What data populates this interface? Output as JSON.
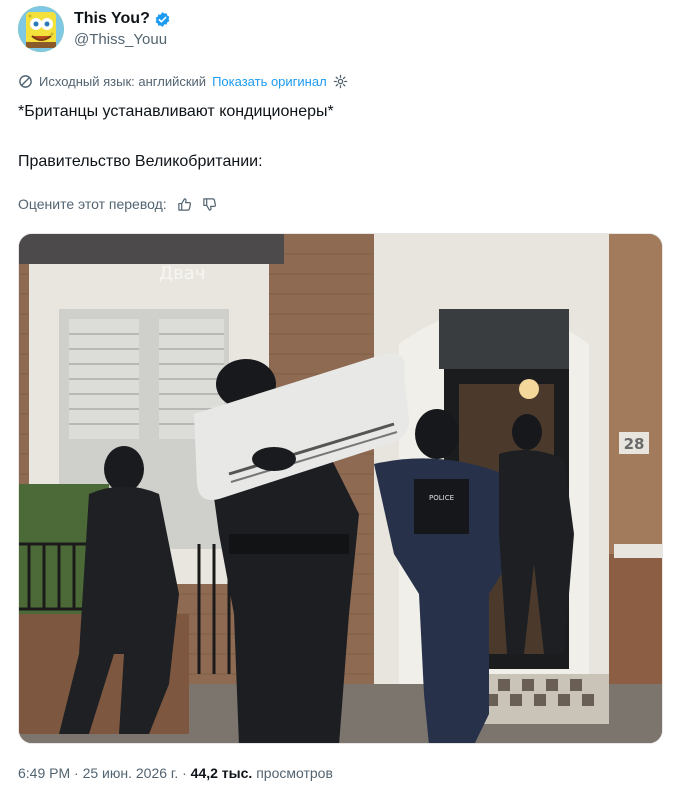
{
  "author": {
    "display_name": "This You?",
    "handle": "@Thiss_Youu",
    "verified": true,
    "avatar_icon": "spongebob-avatar"
  },
  "translation": {
    "source_label": "Исходный язык: английский",
    "show_original": "Показать оригинал",
    "rate_label": "Оцените этот перевод:"
  },
  "tweet": {
    "line1": "*Британцы устанавливают кондиционеры*",
    "line2": "Правительство Великобритании:"
  },
  "media": {
    "watermark": "Двач",
    "house_number": "28",
    "vest_text": "POLICE"
  },
  "meta": {
    "time": "6:49 PM",
    "date": "25 июн. 2026 г.",
    "views_count": "44,2 тыс.",
    "views_label": "просмотров"
  },
  "colors": {
    "accent": "#1d9bf0",
    "secondary_text": "#536471",
    "primary_text": "#0f1419"
  }
}
